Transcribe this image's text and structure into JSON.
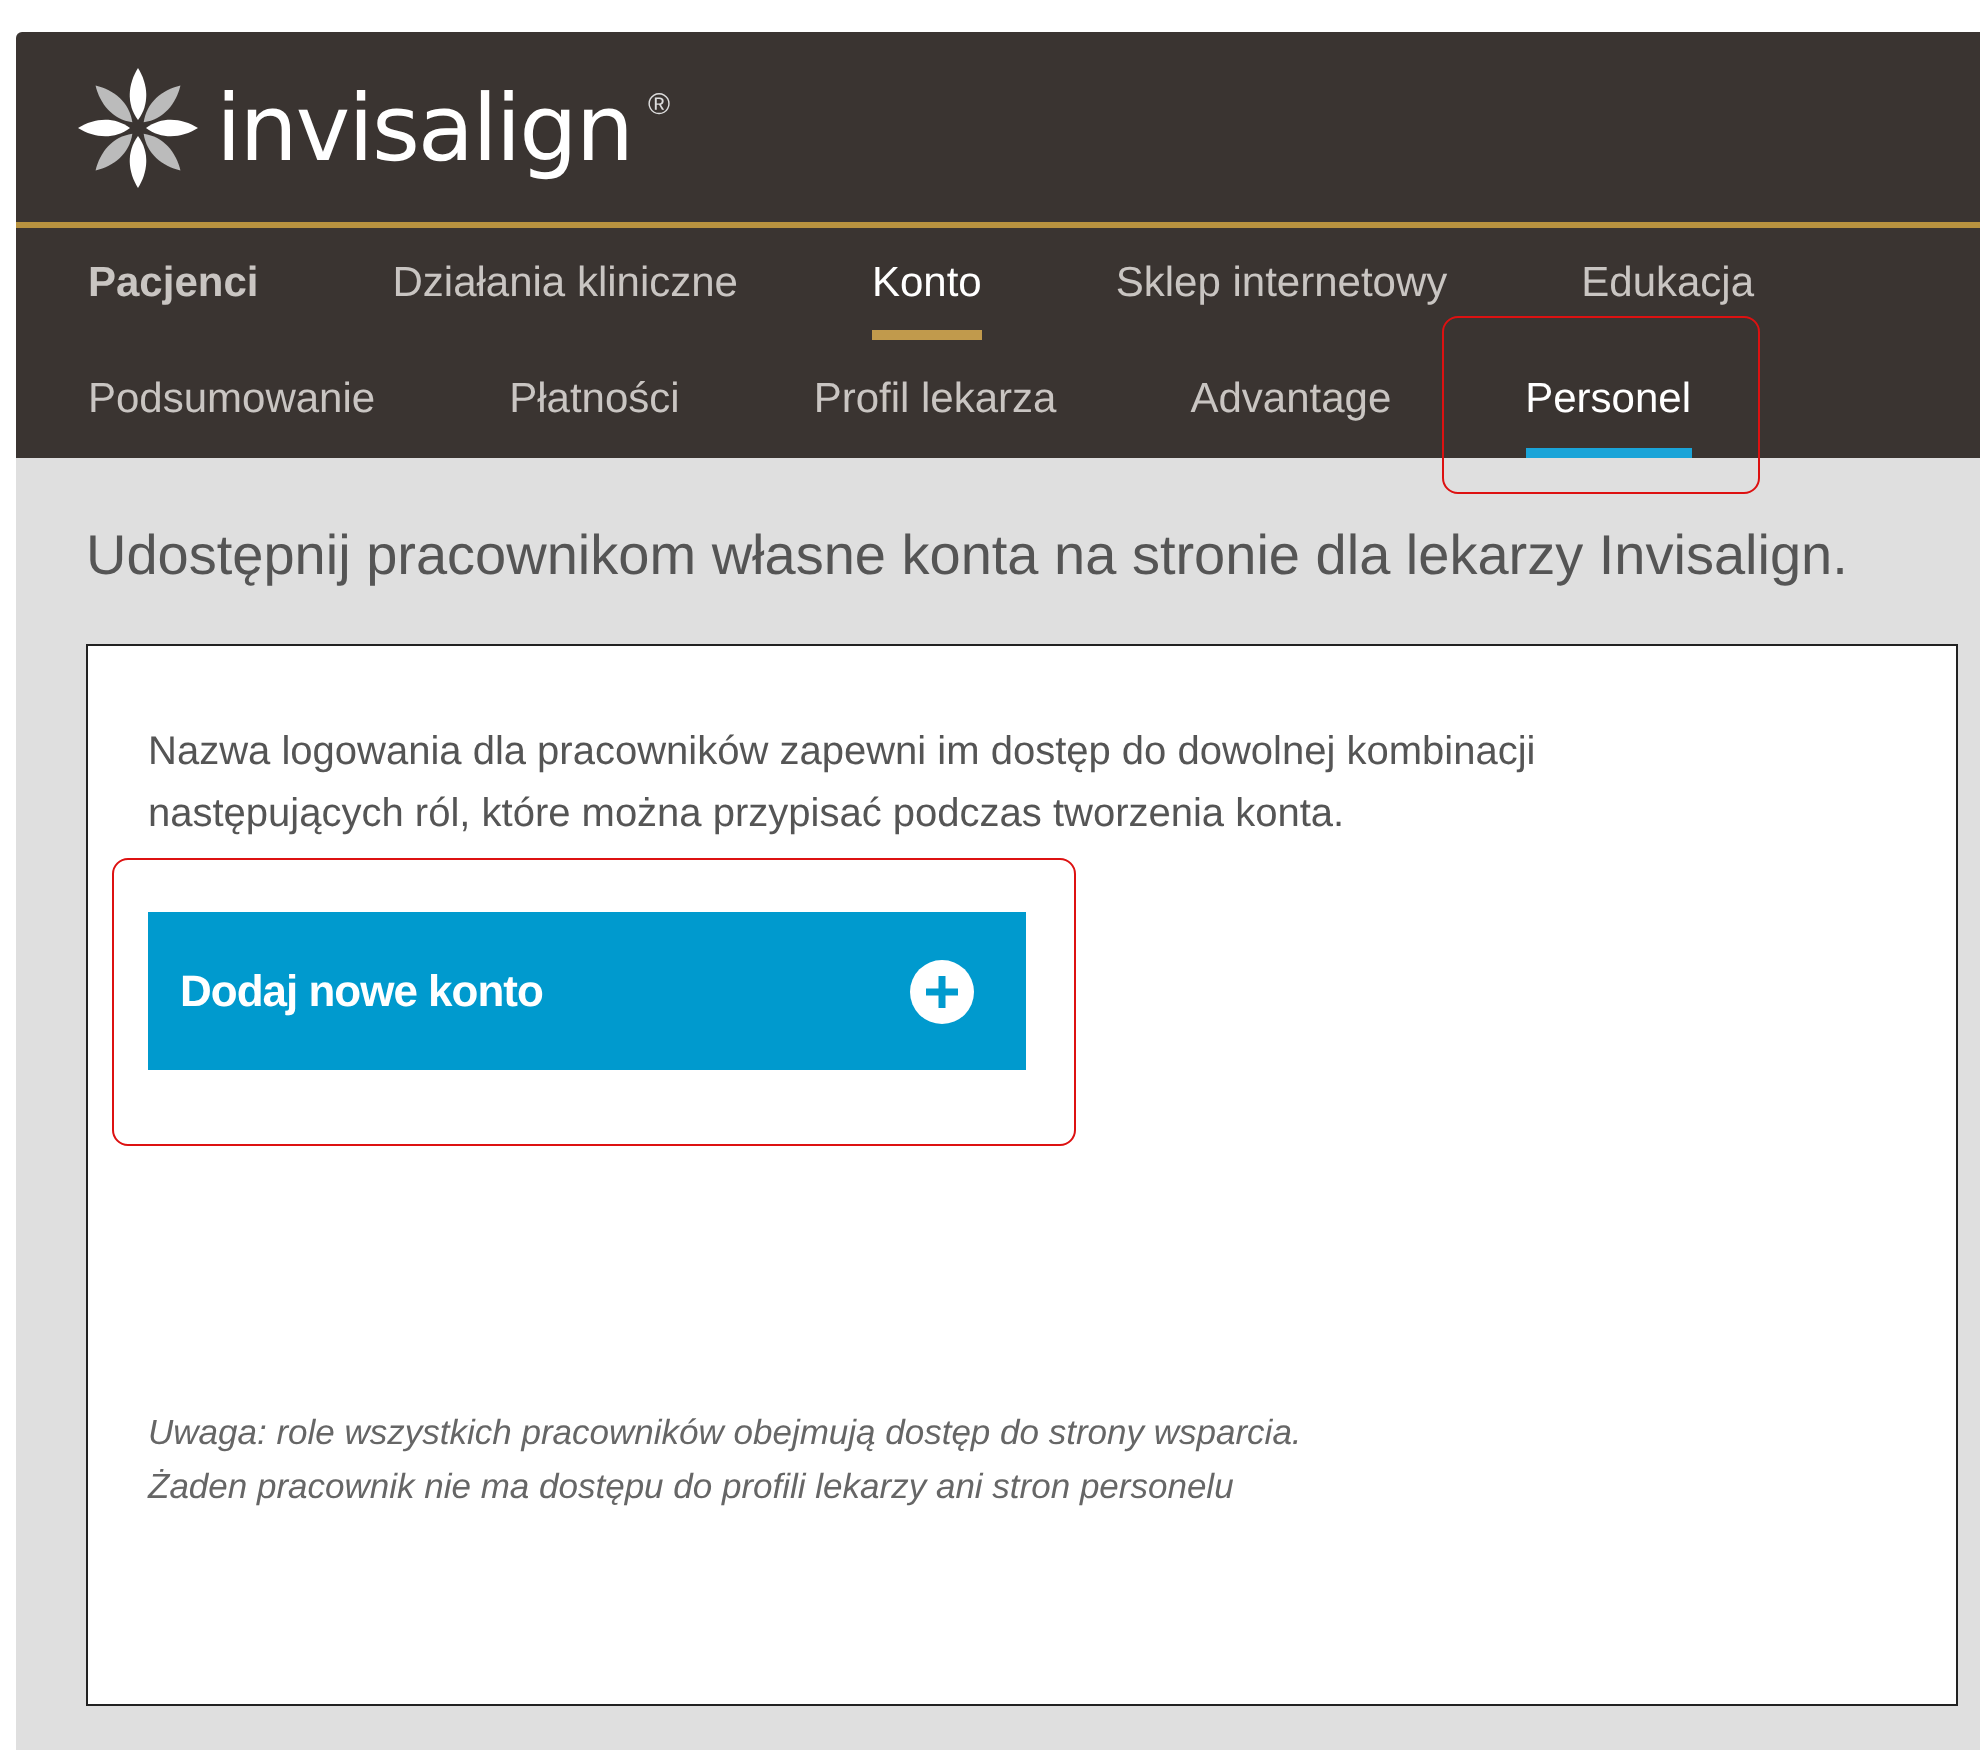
{
  "header": {
    "logo": {
      "wordmark": "invisalign",
      "mark": "®"
    }
  },
  "main_nav": [
    {
      "label": "Pacjenci",
      "selected": false,
      "kind": "bold"
    },
    {
      "label": "Działania kliniczne",
      "selected": false,
      "kind": "plain"
    },
    {
      "label": "Konto",
      "selected": true,
      "kind": "plain"
    },
    {
      "label": "Sklep internetowy",
      "selected": false,
      "kind": "plain"
    },
    {
      "label": "Edukacja",
      "selected": false,
      "kind": "plain"
    }
  ],
  "sub_nav": [
    {
      "label": "Podsumowanie",
      "selected": false,
      "annotated": false
    },
    {
      "label": "Płatności",
      "selected": false,
      "annotated": false
    },
    {
      "label": "Profil lekarza",
      "selected": false,
      "annotated": false
    },
    {
      "label": "Advantage",
      "selected": false,
      "annotated": false
    },
    {
      "label": "Personel",
      "selected": true,
      "annotated": true
    }
  ],
  "heading": "Udostępnij pracownikom własne konta na stronie dla lekarzy Invisalign.",
  "card": {
    "intro": "Nazwa logowania dla pracowników zapewni im dostęp do dowolnej kombinacji następujących ról, które można przypisać podczas tworzenia konta.",
    "add_button": {
      "label": "Dodaj nowe konto",
      "annotated": true
    },
    "notes": [
      "Uwaga: role wszystkich pracowników obejmują dostęp do strony wsparcia.",
      "Żaden pracownik nie ma dostępu do profili lekarzy ani stron personelu"
    ]
  }
}
